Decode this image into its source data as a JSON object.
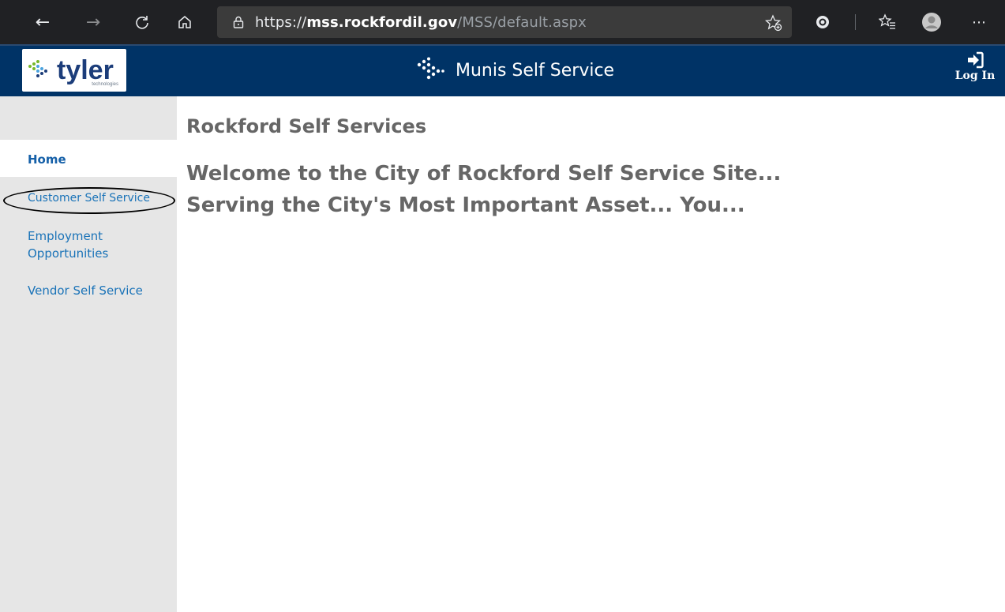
{
  "browser": {
    "url_scheme": "https://",
    "url_domain": "mss.rockfordil.gov",
    "url_path": "/MSS/default.aspx"
  },
  "header": {
    "logo_text": "tyler",
    "logo_subtext": "technologies",
    "app_title": "Munis Self Service",
    "login_label": "Log In",
    "brand_color": "#003366"
  },
  "sidebar": {
    "items": [
      {
        "label": "Home",
        "active": true
      },
      {
        "label": "Customer Self Service",
        "active": false
      },
      {
        "label": "Employment Opportunities",
        "active": false
      },
      {
        "label": "Vendor Self Service",
        "active": false
      }
    ]
  },
  "main": {
    "page_title": "Rockford Self Services",
    "welcome_line1": "Welcome to the City of Rockford Self Service Site...",
    "welcome_line2": "Serving the City's Most Important Asset... You..."
  }
}
